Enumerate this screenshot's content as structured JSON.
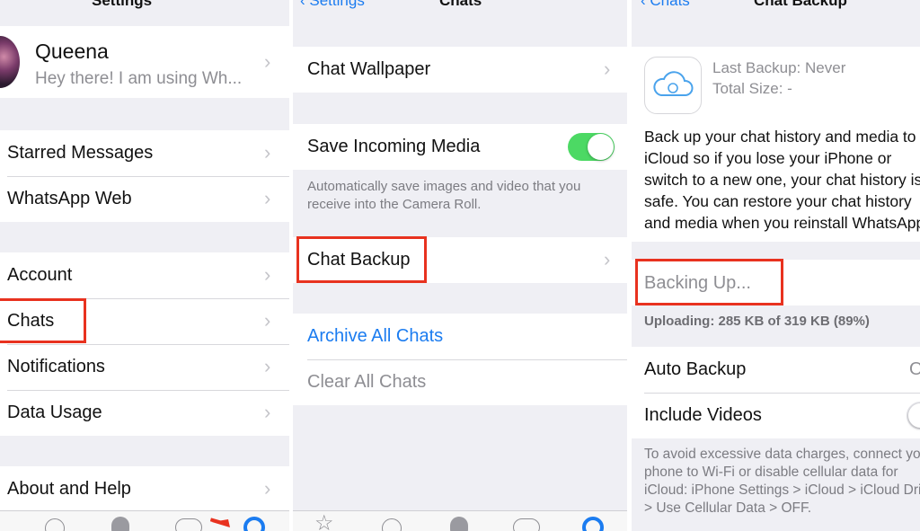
{
  "panel1": {
    "nav_title": "Settings",
    "profile": {
      "name": "Queena",
      "status": "Hey there! I am using Wh..."
    },
    "items": [
      "Starred Messages",
      "WhatsApp Web",
      "Account",
      "Chats",
      "Notifications",
      "Data Usage",
      "About and Help"
    ],
    "tabs": [
      "clock-icon",
      "camera-icon",
      "chats-icon",
      "settings-icon"
    ]
  },
  "panel2": {
    "nav_back": "Settings",
    "nav_title": "Chats",
    "chat_wallpaper": "Chat Wallpaper",
    "save_incoming_media": "Save Incoming Media",
    "save_incoming_media_on": true,
    "media_footer": "Automatically save images and video that you receive into the Camera Roll.",
    "chat_backup": "Chat Backup",
    "archive_all": "Archive All Chats",
    "clear_all": "Clear All Chats",
    "tabs": [
      "star-icon",
      "clock-icon",
      "camera-icon",
      "chats-icon",
      "settings-icon"
    ]
  },
  "panel3": {
    "nav_back": "Chats",
    "nav_title": "Chat Backup",
    "last_backup": "Last Backup: Never",
    "total_size": "Total Size: -",
    "description": "Back up your chat history and media to iCloud so if you lose your iPhone or switch to a new one, your chat history is safe. You can restore your chat history and media when you reinstall WhatsApp.",
    "backing_up": "Backing Up...",
    "uploading": "Uploading: 285 KB of 319 KB (89%)",
    "upload_progress": 0.89,
    "auto_backup": "Auto Backup",
    "auto_backup_value": "Off",
    "include_videos": "Include Videos",
    "footer": "To avoid excessive data charges, connect your phone to Wi-Fi or disable cellular data for iCloud: iPhone Settings > iCloud > iCloud Drive > Use Cellular Data > OFF."
  },
  "colors": {
    "accent": "#1b7cf0",
    "toggle_on": "#4cd964",
    "highlight": "#e8321f"
  }
}
